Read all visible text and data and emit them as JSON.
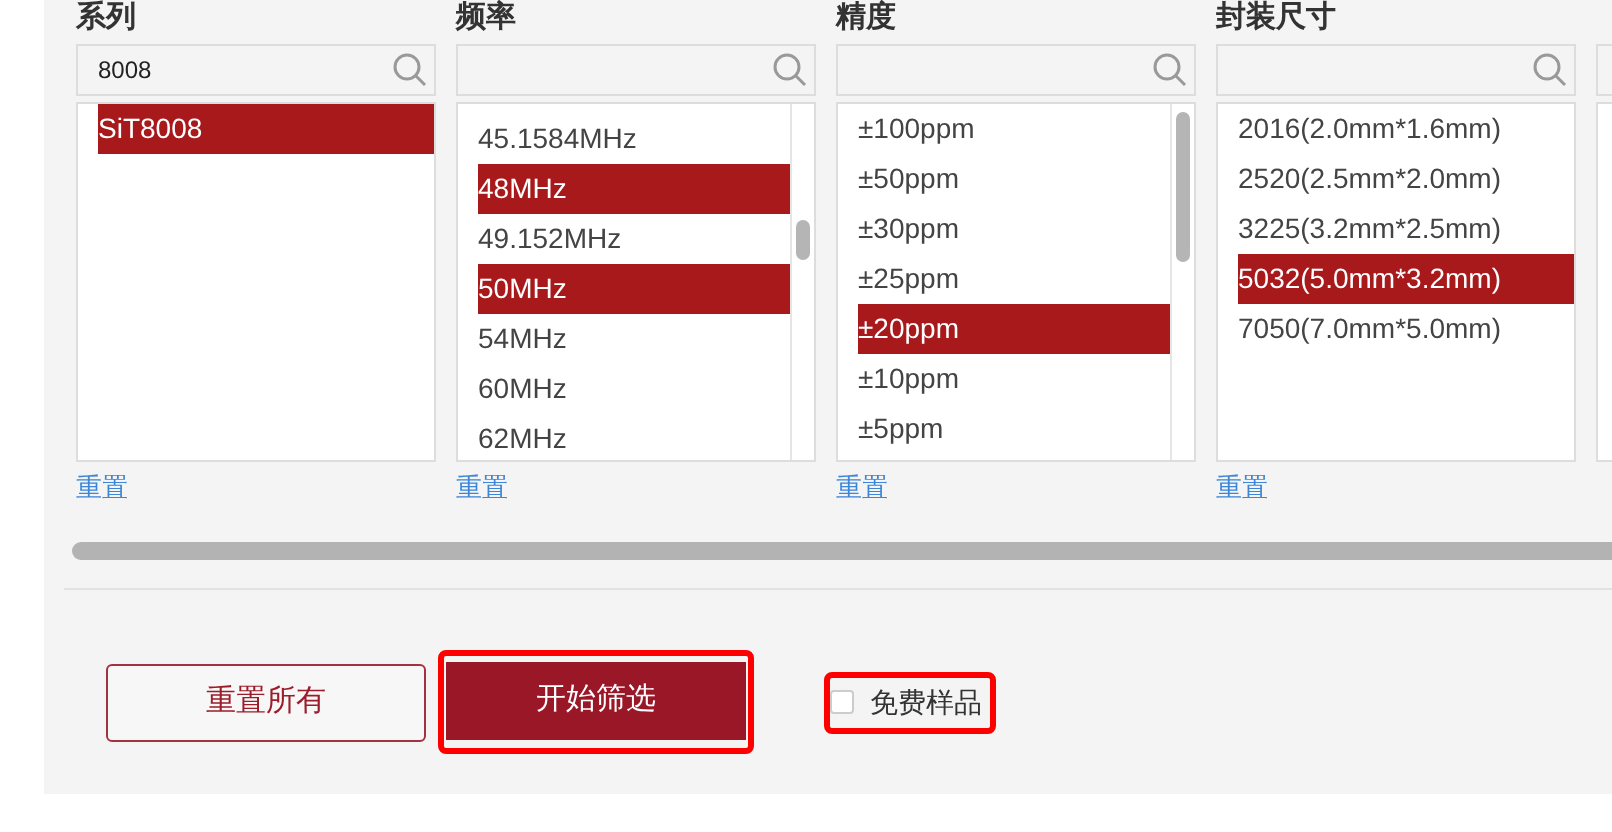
{
  "filters": [
    {
      "title": "系列",
      "search": {
        "value": "8008"
      },
      "items": [
        {
          "label": "SiT8008",
          "selected": true
        }
      ],
      "reset": "重置"
    },
    {
      "title": "频率",
      "items": [
        {
          "label": "45.1584MHz",
          "selected": false
        },
        {
          "label": "48MHz",
          "selected": true
        },
        {
          "label": "49.152MHz",
          "selected": false
        },
        {
          "label": "50MHz",
          "selected": true
        },
        {
          "label": "54MHz",
          "selected": false
        },
        {
          "label": "60MHz",
          "selected": false
        },
        {
          "label": "62MHz",
          "selected": false
        }
      ],
      "reset": "重置"
    },
    {
      "title": "精度",
      "items": [
        {
          "label": "±100ppm",
          "selected": false
        },
        {
          "label": "±50ppm",
          "selected": false
        },
        {
          "label": "±30ppm",
          "selected": false
        },
        {
          "label": "±25ppm",
          "selected": false
        },
        {
          "label": "±20ppm",
          "selected": true
        },
        {
          "label": "±10ppm",
          "selected": false
        },
        {
          "label": "±5ppm",
          "selected": false
        }
      ],
      "reset": "重置"
    },
    {
      "title": "封装尺寸",
      "items": [
        {
          "label": "2016(2.0mm*1.6mm)",
          "selected": false
        },
        {
          "label": "2520(2.5mm*2.0mm)",
          "selected": false
        },
        {
          "label": "3225(3.2mm*2.5mm)",
          "selected": false
        },
        {
          "label": "5032(5.0mm*3.2mm)",
          "selected": true
        },
        {
          "label": "7050(7.0mm*5.0mm)",
          "selected": false
        }
      ],
      "reset": "重置"
    }
  ],
  "actions": {
    "reset_all": "重置所有",
    "start": "开始筛选",
    "free_sample": {
      "label": "免费样品",
      "checked": false
    }
  }
}
